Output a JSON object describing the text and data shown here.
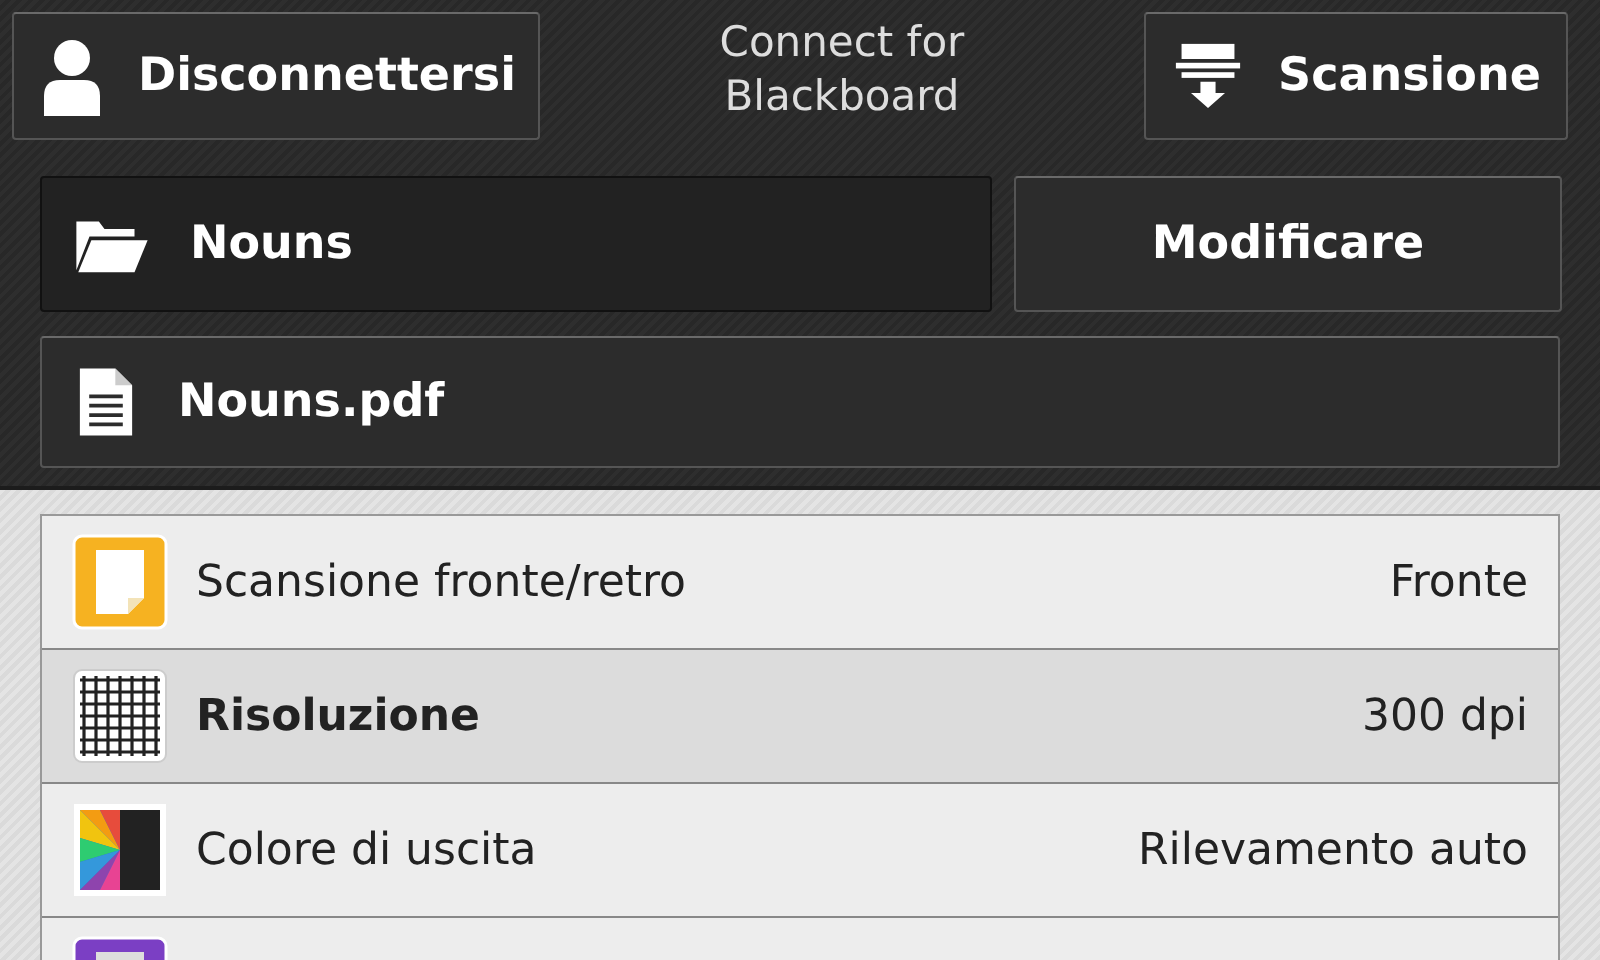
{
  "header": {
    "logout_button": "Disconnettersi",
    "title": "Connect for Blackboard",
    "scan_button": "Scansione"
  },
  "folder": {
    "label": "Nouns",
    "edit_button": "Modificare"
  },
  "file": {
    "label": "Nouns.pdf"
  },
  "settings": [
    {
      "kind": "duplex",
      "label": "Scansione fronte/retro",
      "value": "Fronte",
      "selected": false
    },
    {
      "kind": "resolution",
      "label": "Risoluzione",
      "value": "300 dpi",
      "selected": true
    },
    {
      "kind": "color",
      "label": "Colore di uscita",
      "value": "Rilevamento auto",
      "selected": false
    },
    {
      "kind": "other",
      "selected": false
    }
  ]
}
